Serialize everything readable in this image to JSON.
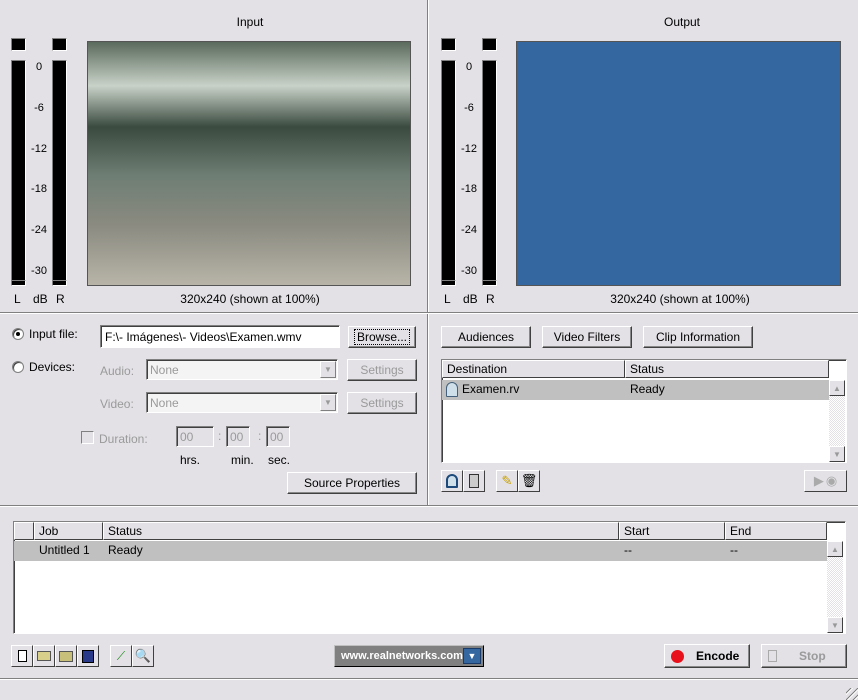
{
  "input": {
    "title": "Input",
    "caption": "320x240 (shown at 100%)",
    "meter_labels": {
      "left": "L",
      "db": "dB",
      "right": "R"
    },
    "meter_ticks": [
      "0",
      "-6",
      "-12",
      "-18",
      "-24",
      "-30"
    ]
  },
  "output": {
    "title": "Output",
    "caption": "320x240 (shown at 100%)",
    "preview_color": "#3466a0",
    "meter_labels": {
      "left": "L",
      "db": "dB",
      "right": "R"
    },
    "meter_ticks": [
      "0",
      "-6",
      "-12",
      "-18",
      "-24",
      "-30"
    ]
  },
  "source": {
    "input_file_label": "Input file:",
    "input_file_value": "F:\\- Imágenes\\- Videos\\Examen.wmv",
    "browse_label": "Browse...",
    "devices_label": "Devices:",
    "audio_label": "Audio:",
    "audio_value": "None",
    "video_label": "Video:",
    "video_value": "None",
    "settings_label": "Settings",
    "duration_label": "Duration:",
    "hrs": "00",
    "min": "00",
    "sec": "00",
    "hrs_label": "hrs.",
    "min_label": "min.",
    "sec_label": "sec.",
    "source_properties_label": "Source Properties",
    "selected": "input_file"
  },
  "destination": {
    "audiences_label": "Audiences",
    "video_filters_label": "Video Filters",
    "clip_information_label": "Clip Information",
    "columns": [
      "Destination",
      "Status"
    ],
    "rows": [
      {
        "destination": "Examen.rv",
        "status": "Ready"
      }
    ]
  },
  "jobs": {
    "columns": [
      "Job",
      "Status",
      "Start",
      "End"
    ],
    "rows": [
      {
        "job": "Untitled 1",
        "status": "Ready",
        "start": "--",
        "end": "--"
      }
    ]
  },
  "toolbar": {
    "website": "www.realnetworks.com",
    "encode_label": "Encode",
    "stop_label": "Stop",
    "encode_color": "#e8101a"
  }
}
